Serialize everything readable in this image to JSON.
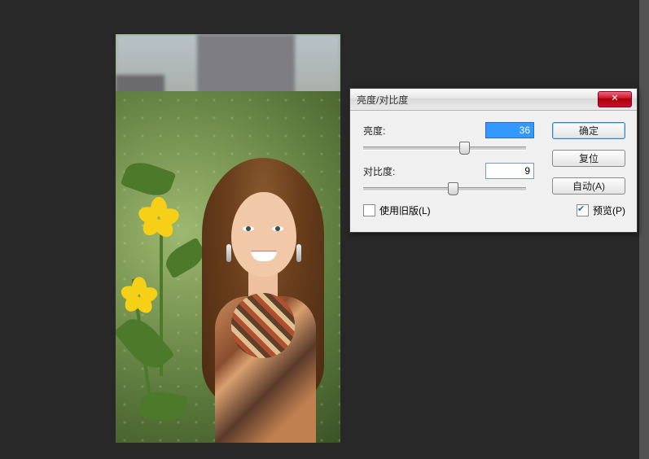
{
  "dialog": {
    "title": "亮度/对比度",
    "brightness": {
      "label": "亮度:",
      "value": "36",
      "min": -150,
      "max": 150
    },
    "contrast": {
      "label": "对比度:",
      "value": "9",
      "min": -100,
      "max": 100
    },
    "legacy": {
      "label": "使用旧版(L)",
      "checked": false
    },
    "preview": {
      "label": "预览(P)",
      "checked": true
    },
    "buttons": {
      "ok": "确定",
      "cancel": "复位",
      "auto": "自动(A)"
    },
    "close_glyph": "✕"
  }
}
